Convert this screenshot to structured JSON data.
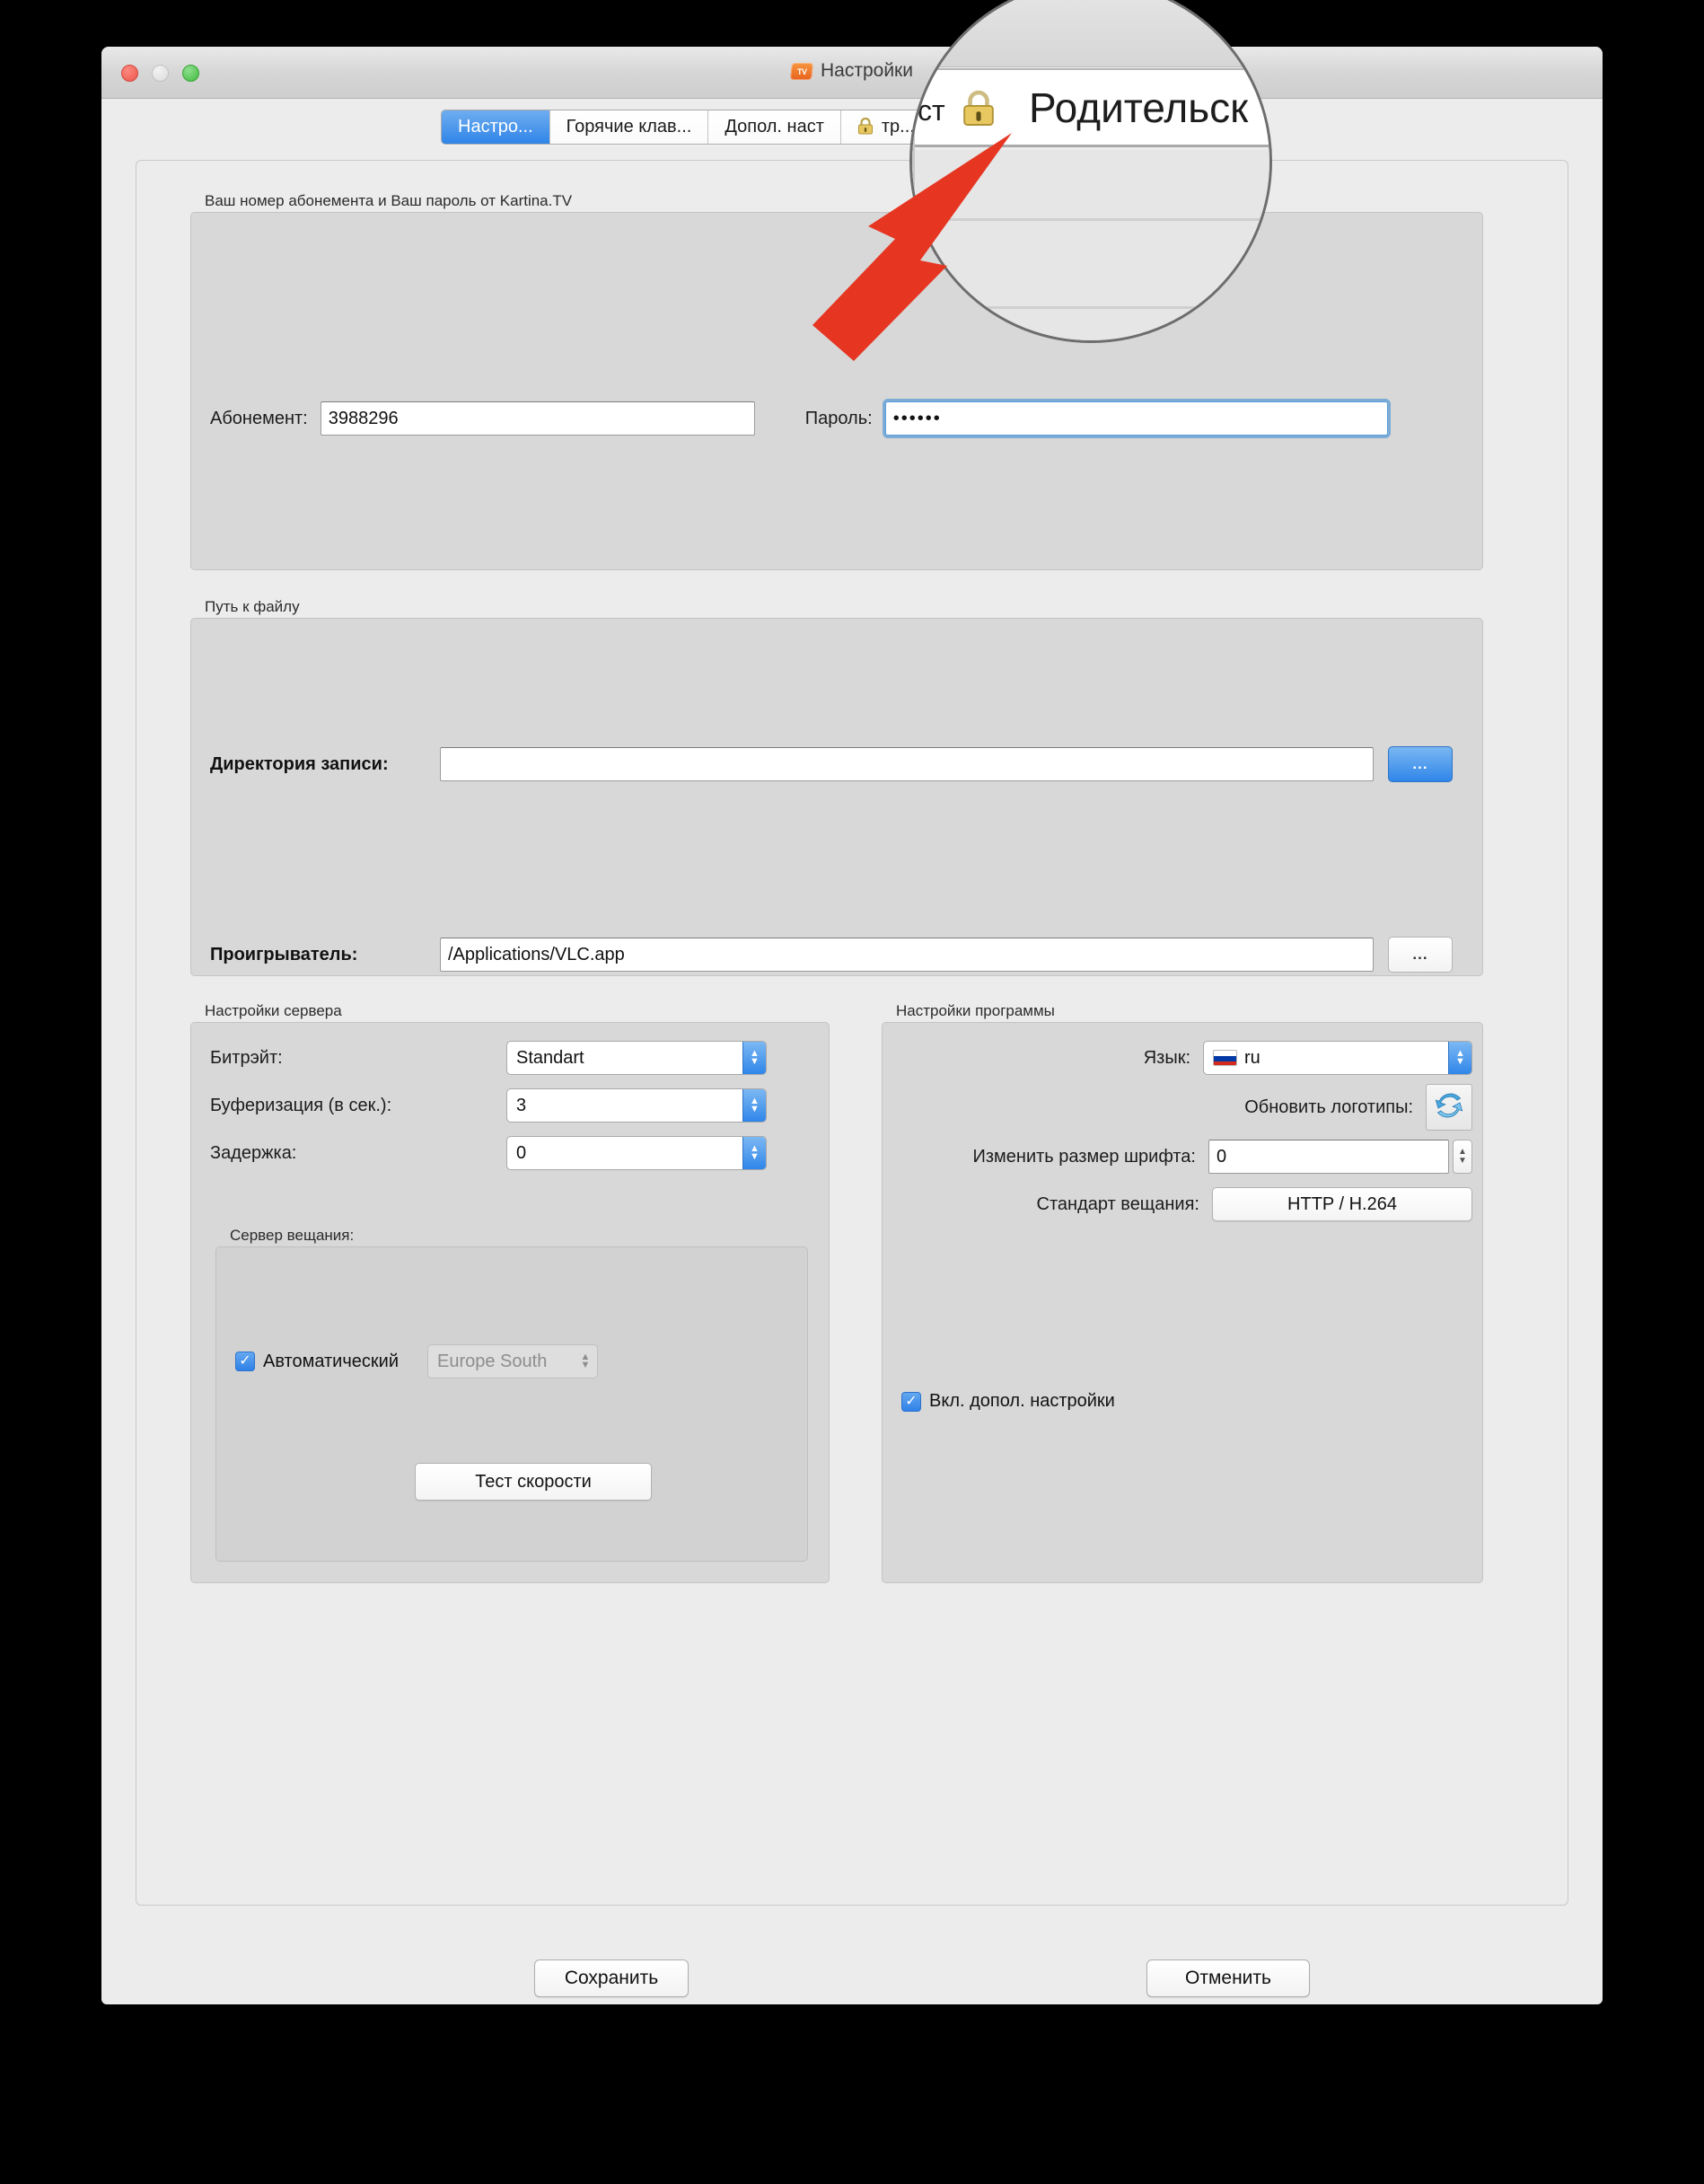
{
  "window": {
    "title": "Настройки",
    "logo_text": "TV",
    "traffic_lights": [
      "close",
      "minimize",
      "zoom"
    ]
  },
  "tabs": [
    {
      "label": "Настро...",
      "active": true,
      "icon": null
    },
    {
      "label": "Горячие клав...",
      "active": false,
      "icon": null
    },
    {
      "label": "Допол. наст",
      "active": false,
      "icon": null
    },
    {
      "label": "тр...",
      "active": false,
      "icon": "lock-icon"
    }
  ],
  "magnifier": {
    "revealed_tab_label": "Родительск",
    "revealed_tab_icon": "lock-icon",
    "left_fragment": "ст",
    "arrow_color": "#e63622",
    "ring_color": "#6d6d6d"
  },
  "subscriber_group": {
    "label": "Ваш номер абонемента и Ваш пароль от Kartina.TV",
    "subscriber_label": "Абонемент:",
    "subscriber_value": "3988296",
    "password_label": "Пароль:",
    "password_value": "••••••",
    "password_focused": true
  },
  "path_group": {
    "label": "Путь к файлу",
    "rows": [
      {
        "label": "Директория записи:",
        "value": "",
        "button_label": "...",
        "button_style": "primary"
      },
      {
        "label": "Проигрыватель:",
        "value": "/Applications/VLC.app",
        "button_label": "...",
        "button_style": "plain"
      }
    ]
  },
  "server_group": {
    "label": "Настройки сервера",
    "bitrate_label": "Битрэйт:",
    "bitrate_value": "Standart",
    "buffer_label": "Буферизация (в сек.):",
    "buffer_value": "3",
    "delay_label": "Задержка:",
    "delay_value": "0",
    "broadcast": {
      "label": "Сервер вещания:",
      "auto_label": "Автоматический",
      "auto_checked": true,
      "server_value": "Europe South",
      "server_disabled": true,
      "speedtest_label": "Тест скорости"
    }
  },
  "program_group": {
    "label": "Настройки программы",
    "language_label": "Язык:",
    "language_value": "ru",
    "language_flag": "ru-flag-icon",
    "logos_label": "Обновить логотипы:",
    "logos_icon": "refresh-icon",
    "fontsize_label": "Изменить размер шрифта:",
    "fontsize_value": "0",
    "standard_label": "Стандарт вещания:",
    "standard_value": "HTTP  / H.264",
    "extra_label": "Вкл. допол. настройки",
    "extra_checked": true
  },
  "footer": {
    "save_label": "Сохранить",
    "cancel_label": "Отменить"
  },
  "colors": {
    "accent_blue": "#2f85e8",
    "window_bg": "#ececec",
    "group_bg": "#d8d8d8",
    "arrow_red": "#e63622"
  }
}
